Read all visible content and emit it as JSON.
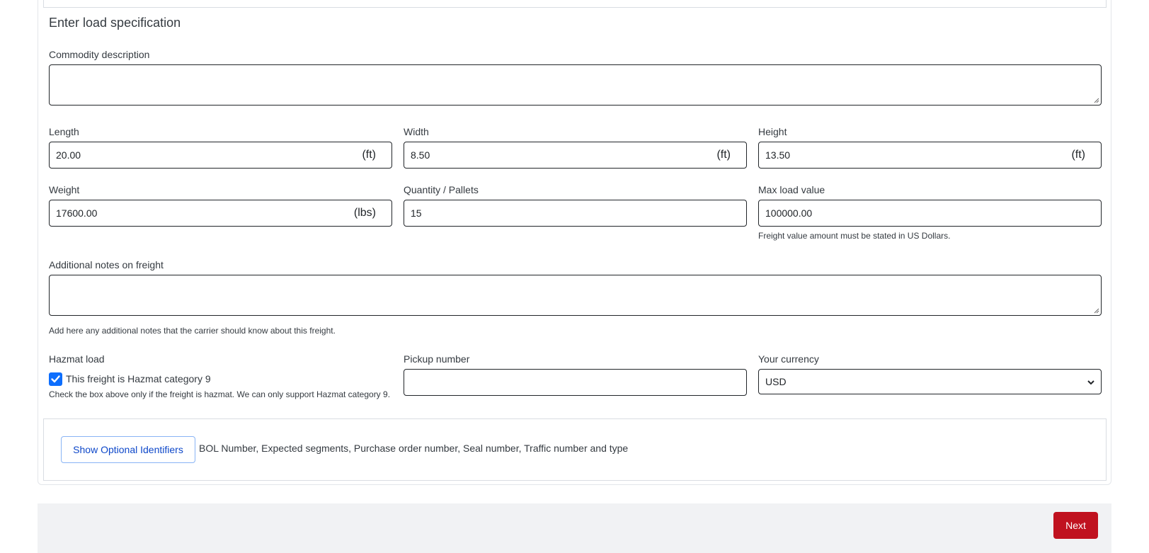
{
  "form": {
    "section_title": "Enter load specification",
    "commodity": {
      "label": "Commodity description",
      "value": ""
    },
    "length": {
      "label": "Length",
      "value": "20.00",
      "unit": "(ft)"
    },
    "width": {
      "label": "Width",
      "value": "8.50",
      "unit": "(ft)"
    },
    "height": {
      "label": "Height",
      "value": "13.50",
      "unit": "(ft)"
    },
    "weight": {
      "label": "Weight",
      "value": "17600.00",
      "unit": "(lbs)"
    },
    "quantity": {
      "label": "Quantity / Pallets",
      "value": "15"
    },
    "max_load_value": {
      "label": "Max load value",
      "value": "100000.00",
      "help": "Freight value amount must be stated in US Dollars."
    },
    "notes": {
      "label": "Additional notes on freight",
      "value": "",
      "help": "Add here any additional notes that the carrier should know about this freight."
    },
    "hazmat": {
      "label": "Hazmat load",
      "checkbox_label": "This freight is Hazmat category 9",
      "checked": true,
      "help": "Check the box above only if the freight is hazmat. We can only support Hazmat category 9."
    },
    "pickup_number": {
      "label": "Pickup number",
      "value": ""
    },
    "currency": {
      "label": "Your currency",
      "selected": "USD"
    }
  },
  "optional_identifiers": {
    "button_label": "Show Optional Identifiers",
    "description": "BOL Number, Expected segments, Purchase order number, Seal number, Traffic number and type"
  },
  "footer": {
    "next_label": "Next"
  },
  "colors": {
    "accent": "#0d6efd",
    "next_button": "#c0121f",
    "link": "#0d47c9"
  }
}
